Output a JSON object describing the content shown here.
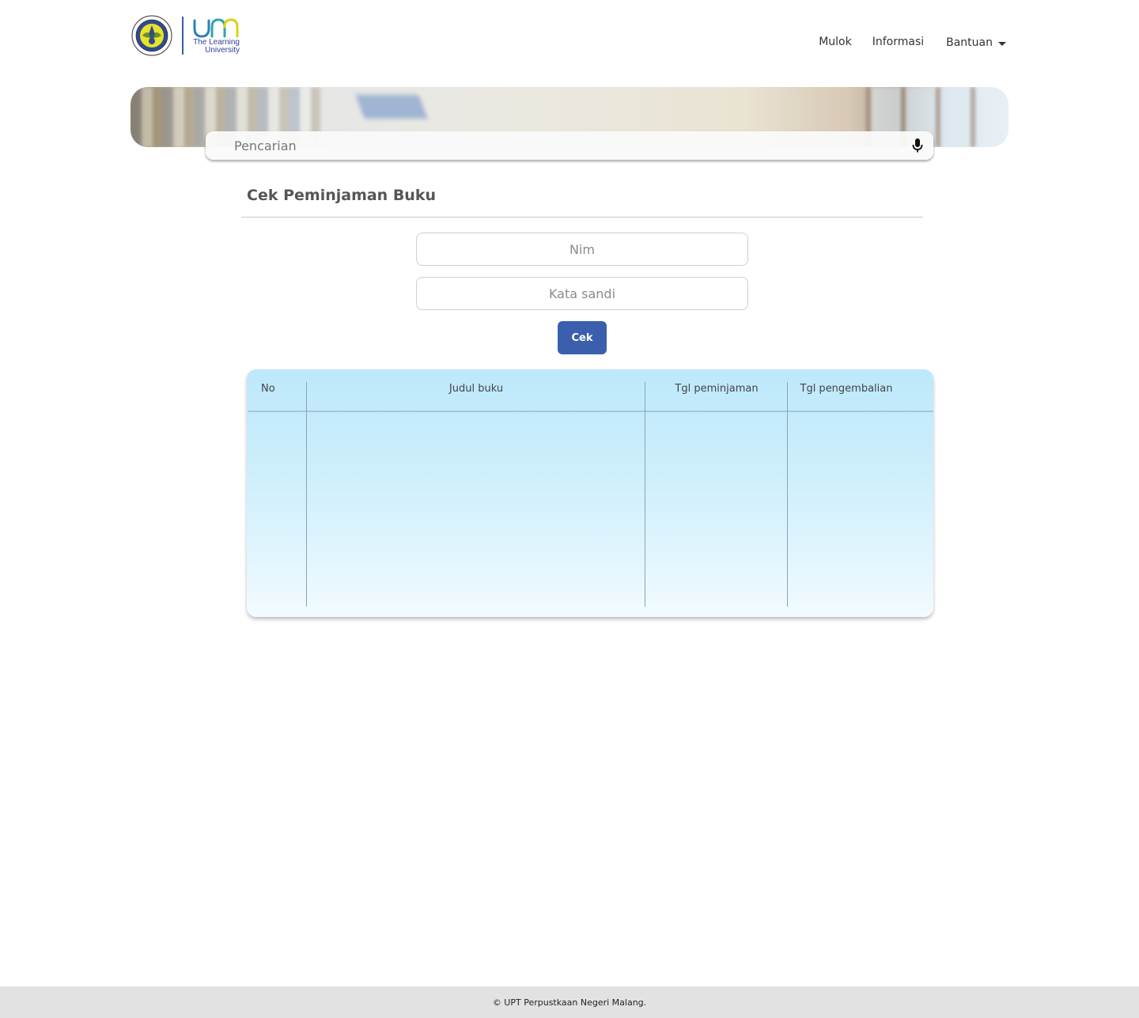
{
  "brand": {
    "tagline_line1": "The Learning",
    "tagline_line2": "University",
    "colors": {
      "um_blue": "#2e3f9a",
      "um_yellow": "#d8d21a",
      "um_teal": "#2ea6a9"
    }
  },
  "nav": {
    "items": [
      {
        "label": "Mulok"
      },
      {
        "label": "Informasi"
      }
    ],
    "dropdown": {
      "label": "Bantuan",
      "icon": "caret-down-icon"
    }
  },
  "search": {
    "placeholder": "Pencarian",
    "icon": "microphone-icon"
  },
  "section": {
    "title": "Cek Peminjaman Buku"
  },
  "form": {
    "nim_placeholder": "Nim",
    "password_placeholder": "Kata sandi",
    "submit_label": "Cek",
    "submit_color": "#3b5fad"
  },
  "table": {
    "columns": [
      "No",
      "Judul buku",
      "Tgl peminjaman",
      "Tgl pengembalian"
    ],
    "rows": []
  },
  "footer": {
    "text": "© UPT Perpustkaan Negeri Malang."
  }
}
